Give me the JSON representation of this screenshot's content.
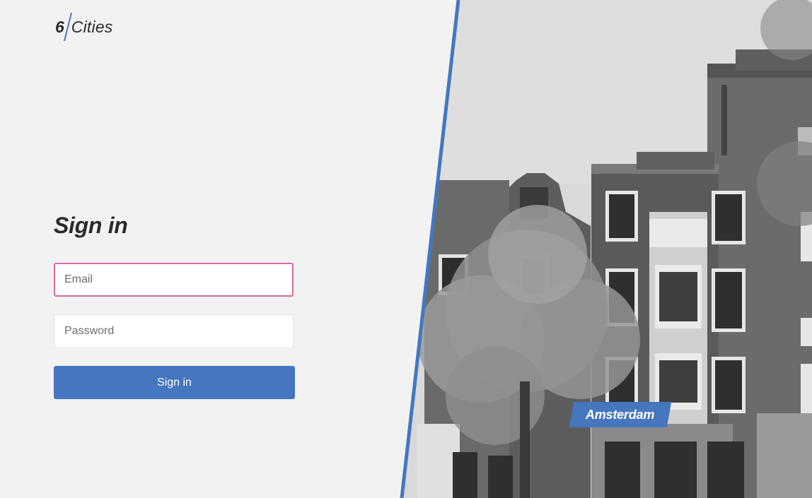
{
  "logo": {
    "number": "6",
    "word": "Cities"
  },
  "login": {
    "title": "Sign in",
    "email_placeholder": "Email",
    "password_placeholder": "Password",
    "submit_label": "Sign in"
  },
  "location": {
    "city": "Amsterdam"
  },
  "colors": {
    "accent": "#4576be",
    "background": "#f2f2f2",
    "focus_border": "#d86aa2",
    "text": "#2b2b2b"
  }
}
